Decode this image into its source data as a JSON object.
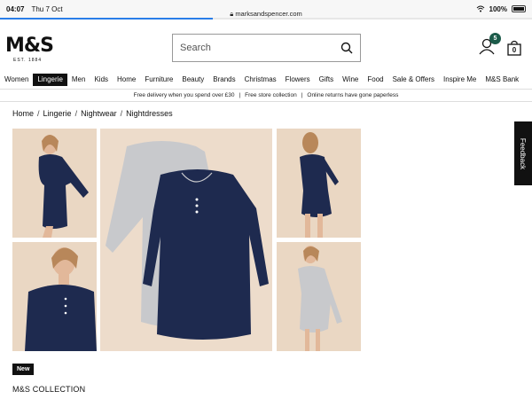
{
  "status_bar": {
    "time": "04:07",
    "date": "Thu 7 Oct",
    "url": "marksandspencer.com",
    "battery": "100%"
  },
  "loading_progress": 0.4,
  "header": {
    "logo": "M&S",
    "logo_sub": "EST. 1884",
    "search_placeholder": "Search",
    "account_badge": "5",
    "bag_count": "0"
  },
  "nav": [
    {
      "label": "Women",
      "active": false
    },
    {
      "label": "Lingerie",
      "active": true
    },
    {
      "label": "Men",
      "active": false
    },
    {
      "label": "Kids",
      "active": false
    },
    {
      "label": "Home",
      "active": false
    },
    {
      "label": "Furniture",
      "active": false
    },
    {
      "label": "Beauty",
      "active": false
    },
    {
      "label": "Brands",
      "active": false
    },
    {
      "label": "Christmas",
      "active": false
    },
    {
      "label": "Flowers",
      "active": false
    },
    {
      "label": "Gifts",
      "active": false
    },
    {
      "label": "Wine",
      "active": false
    },
    {
      "label": "Food",
      "active": false
    },
    {
      "label": "Sale & Offers",
      "active": false
    },
    {
      "label": "Inspire Me",
      "active": false
    },
    {
      "label": "M&S Bank",
      "active": false
    }
  ],
  "promo": [
    "Free delivery when you spend over £30",
    "Free store collection",
    "Online returns have gone paperless"
  ],
  "breadcrumb": [
    "Home",
    "Lingerie",
    "Nightwear",
    "Nightdresses"
  ],
  "feedback_label": "Feedback",
  "product": {
    "badge": "New",
    "brand": "M&S COLLECTION"
  },
  "colors": {
    "navy": "#1e2a4f",
    "grey": "#c8c9cc",
    "skin": "#e9d8c7",
    "accent_green": "#1c5b4a"
  }
}
